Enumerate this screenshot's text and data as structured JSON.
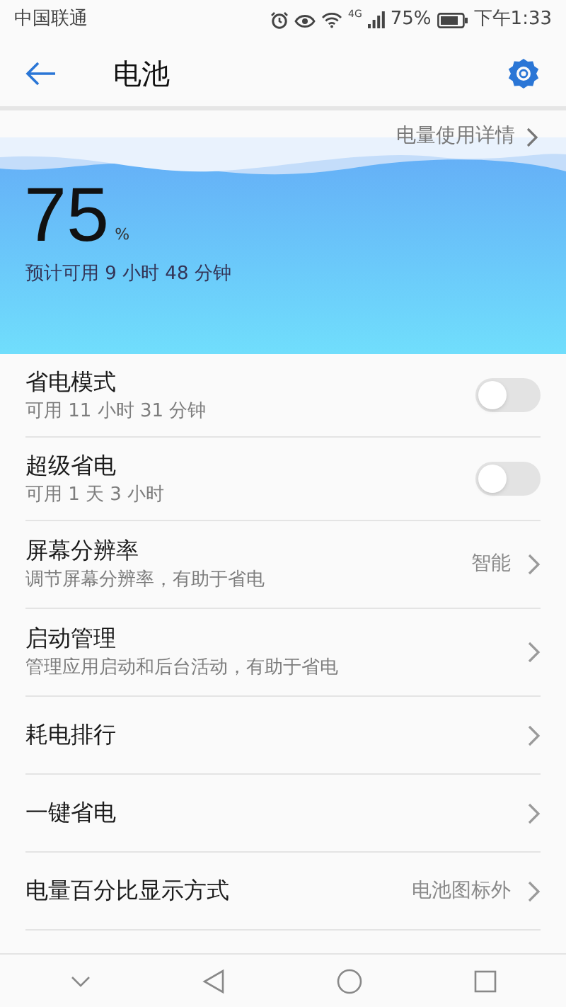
{
  "status_bar": {
    "carrier": "中国联通",
    "network": "4G",
    "battery": "75%",
    "time": "下午1:33"
  },
  "header": {
    "title": "电池"
  },
  "hero": {
    "details_link": "电量使用详情",
    "percent": "75",
    "percent_unit": "%",
    "estimate": "预计可用 9 小时 48 分钟"
  },
  "settings": [
    {
      "kind": "toggle",
      "title": "省电模式",
      "subtitle": "可用 11 小时 31 分钟",
      "on": false
    },
    {
      "kind": "toggle",
      "title": "超级省电",
      "subtitle": "可用 1 天 3 小时",
      "on": false
    },
    {
      "kind": "link",
      "title": "屏幕分辨率",
      "subtitle": "调节屏幕分辨率，有助于省电",
      "value": "智能"
    },
    {
      "kind": "link",
      "title": "启动管理",
      "subtitle": "管理应用启动和后台活动，有助于省电"
    },
    {
      "kind": "link",
      "title": "耗电排行"
    },
    {
      "kind": "link",
      "title": "一键省电"
    },
    {
      "kind": "link",
      "title": "电量百分比显示方式",
      "value": "电池图标外"
    }
  ]
}
